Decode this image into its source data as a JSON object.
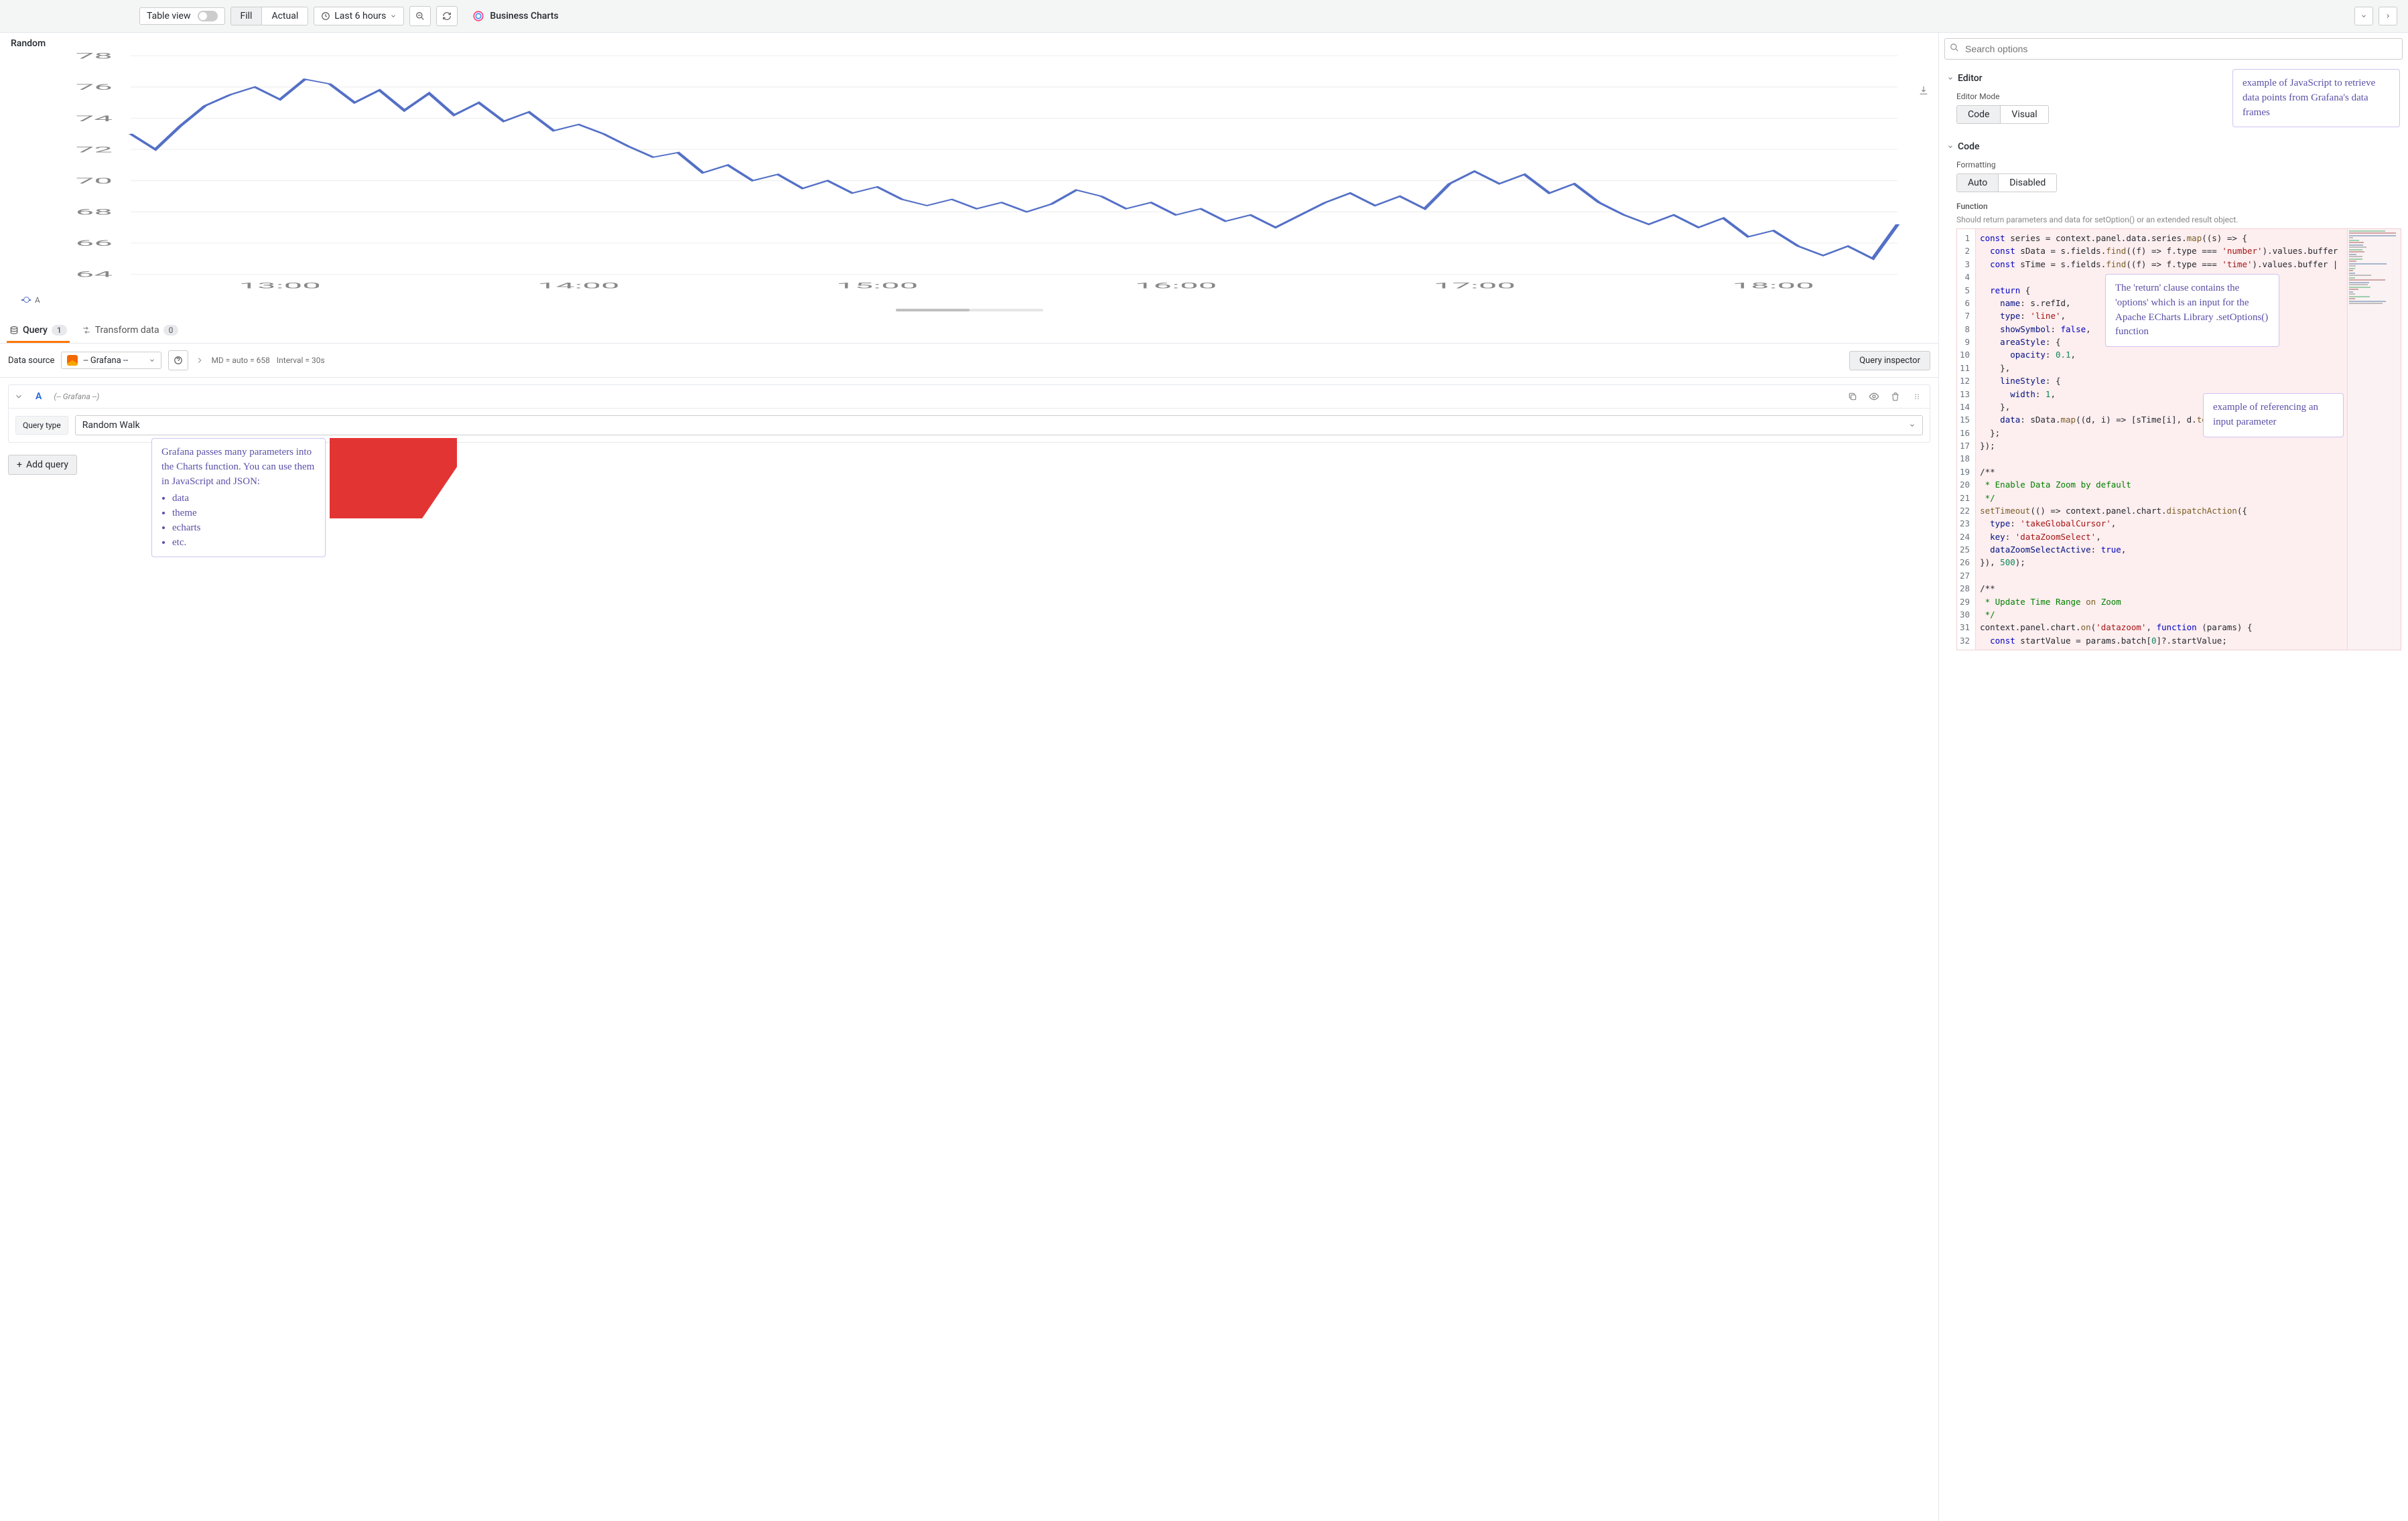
{
  "toolbar": {
    "table_view_label": "Table view",
    "fill_label": "Fill",
    "actual_label": "Actual",
    "time_range": "Last 6 hours",
    "panel_plugin_title": "Business Charts"
  },
  "chart": {
    "title": "Random",
    "legend_series": "A"
  },
  "tabs": {
    "query_label": "Query",
    "query_count": "1",
    "transform_label": "Transform data",
    "transform_count": "0"
  },
  "datasource": {
    "label": "Data source",
    "value": "-- Grafana --",
    "meta_md": "MD = auto = 658",
    "meta_interval": "Interval = 30s",
    "inspector_label": "Query inspector"
  },
  "query": {
    "refId": "A",
    "name_hint": "(-- Grafana --)",
    "type_label": "Query type",
    "type_value": "Random Walk",
    "add_query_label": "Add query"
  },
  "right": {
    "search_placeholder": "Search options",
    "section_editor": "Editor",
    "editor_mode_label": "Editor Mode",
    "mode_code": "Code",
    "mode_visual": "Visual",
    "section_code": "Code",
    "formatting_label": "Formatting",
    "fmt_auto": "Auto",
    "fmt_disabled": "Disabled",
    "function_label": "Function",
    "function_help": "Should return parameters and data for setOption() or an extended result object."
  },
  "code_lines": [
    "const series = context.panel.data.series.map((s) => {",
    "  const sData = s.fields.find((f) => f.type === 'number').values.buffer",
    "  const sTime = s.fields.find((f) => f.type === 'time').values.buffer |",
    "",
    "  return {",
    "    name: s.refId,",
    "    type: 'line',",
    "    showSymbol: false,",
    "    areaStyle: {",
    "      opacity: 0.1,",
    "    },",
    "    lineStyle: {",
    "      width: 1,",
    "    },",
    "    data: sData.map((d, i) => [sTime[i], d.toFixed(2)]),",
    "  };",
    "});",
    "",
    "/**",
    " * Enable Data Zoom by default",
    " */",
    "setTimeout(() => context.panel.chart.dispatchAction({",
    "  type: 'takeGlobalCursor',",
    "  key: 'dataZoomSelect',",
    "  dataZoomSelectActive: true,",
    "}), 500);",
    "",
    "/**",
    " * Update Time Range on Zoom",
    " */",
    "context.panel.chart.on('datazoom', function (params) {",
    "  const startValue = params.batch[0]?.startValue;"
  ],
  "callouts": {
    "params_title": "Grafana passes many parameters into the Charts function. You can use them in JavaScript and JSON:",
    "params_items": [
      "data",
      "theme",
      "echarts",
      "etc."
    ],
    "js_example": "example of JavaScript to retrieve data points from Grafana's data frames",
    "return_clause": "The 'return' clause contains the 'options' which is an input for the Apache ECharts Library .setOptions() function",
    "input_param": "example of referencing an input parameter"
  },
  "chart_data": {
    "type": "line",
    "title": "Random",
    "xlabel": "",
    "ylabel": "",
    "x_ticks": [
      "13:00",
      "14:00",
      "15:00",
      "16:00",
      "17:00",
      "18:00"
    ],
    "ylim": [
      64,
      78
    ],
    "series": [
      {
        "name": "A",
        "color": "#5470c6",
        "x": [
          "12:30",
          "12:35",
          "12:40",
          "12:45",
          "12:50",
          "12:55",
          "13:00",
          "13:05",
          "13:10",
          "13:15",
          "13:20",
          "13:25",
          "13:30",
          "13:35",
          "13:40",
          "13:45",
          "13:50",
          "13:55",
          "14:00",
          "14:05",
          "14:10",
          "14:15",
          "14:20",
          "14:25",
          "14:30",
          "14:35",
          "14:40",
          "14:45",
          "14:50",
          "14:55",
          "15:00",
          "15:05",
          "15:10",
          "15:15",
          "15:20",
          "15:25",
          "15:30",
          "15:35",
          "15:40",
          "15:45",
          "15:50",
          "15:55",
          "16:00",
          "16:05",
          "16:10",
          "16:15",
          "16:20",
          "16:25",
          "16:30",
          "16:35",
          "16:40",
          "16:45",
          "16:50",
          "16:55",
          "17:00",
          "17:05",
          "17:10",
          "17:15",
          "17:20",
          "17:25",
          "17:30",
          "17:35",
          "17:40",
          "17:45",
          "17:50",
          "17:55",
          "18:00",
          "18:05",
          "18:10",
          "18:15",
          "18:20",
          "18:25"
        ],
        "values": [
          73.0,
          72.0,
          73.5,
          74.8,
          75.5,
          76.0,
          75.2,
          76.5,
          76.2,
          75.0,
          75.8,
          74.5,
          75.6,
          74.2,
          75.0,
          73.8,
          74.4,
          73.2,
          73.6,
          73.0,
          72.2,
          71.5,
          71.8,
          70.5,
          71.0,
          70.0,
          70.4,
          69.5,
          70.0,
          69.2,
          69.6,
          68.8,
          68.4,
          68.8,
          68.2,
          68.6,
          68.0,
          68.5,
          69.4,
          69.0,
          68.2,
          68.6,
          67.8,
          68.2,
          67.4,
          67.8,
          67.0,
          67.8,
          68.6,
          69.2,
          68.4,
          69.0,
          68.2,
          69.8,
          70.6,
          69.8,
          70.4,
          69.2,
          69.8,
          68.6,
          67.8,
          67.2,
          67.8,
          67.0,
          67.6,
          66.4,
          66.8,
          65.8,
          65.2,
          65.8,
          65.0,
          67.2
        ]
      }
    ]
  }
}
